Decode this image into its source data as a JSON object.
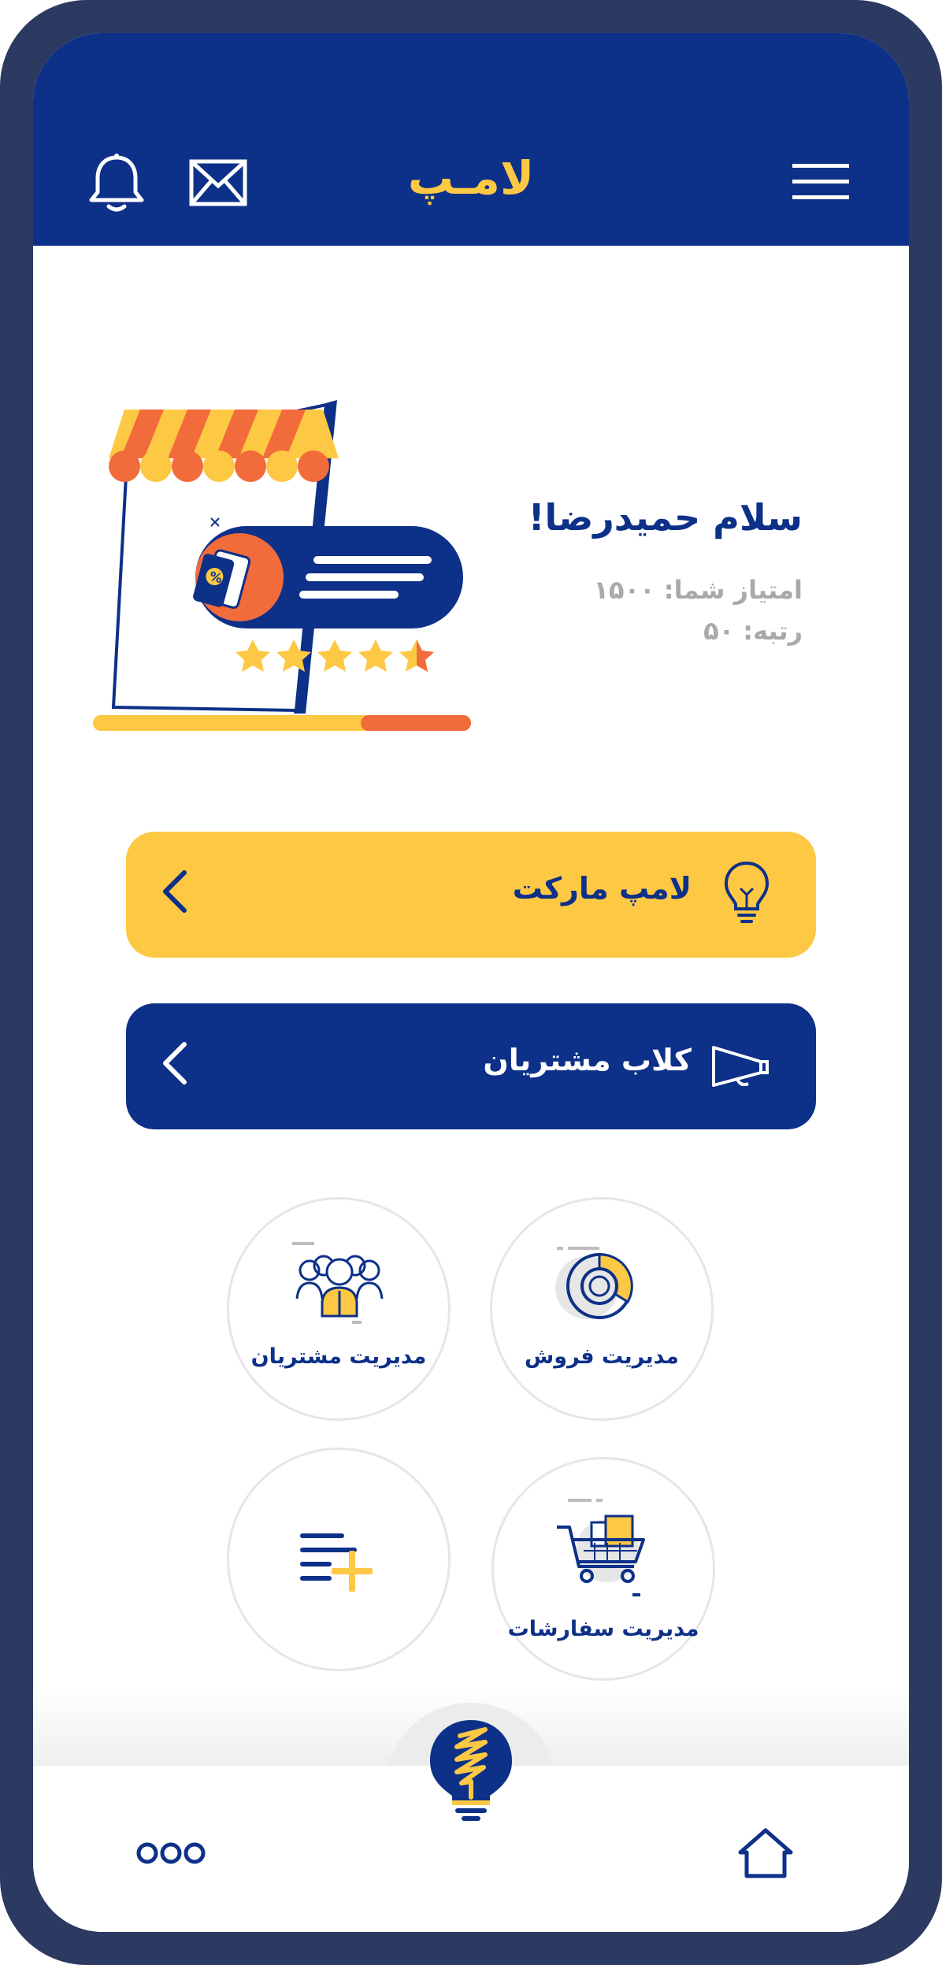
{
  "header": {
    "title": "لامـپ",
    "menu_icon": "hamburger-menu-icon",
    "mail_icon": "envelope-icon",
    "bell_icon": "bell-icon"
  },
  "profile": {
    "greeting": "سلام حمیدرضا!",
    "points_line": "امتیاز شما: ۱۵۰۰",
    "rank_line": "رتبه: ۵۰",
    "rating_stars": 4.5,
    "illustration": "storefront-illustration"
  },
  "actions": {
    "market": {
      "label": "لامپ مارکت",
      "icon": "lightbulb-icon"
    },
    "club": {
      "label": "کلاب مشتریان",
      "icon": "megaphone-icon"
    }
  },
  "tiles": {
    "sales": {
      "label": "مدیریت فروش",
      "icon": "pie-chart-icon"
    },
    "customers": {
      "label": "مدیریت مشتریان",
      "icon": "users-group-icon"
    },
    "orders": {
      "label": "مدیریت سفارشات",
      "icon": "shopping-cart-icon"
    },
    "add": {
      "label": "",
      "icon": "add-list-icon"
    }
  },
  "bottom_nav": {
    "more_icon": "more-dots-icon",
    "home_icon": "home-icon",
    "center_icon": "bulb-logo-icon"
  },
  "colors": {
    "primary": "#0d3088",
    "accent": "#fdc844",
    "frame": "#2c3a61",
    "orange": "#f26b3a"
  }
}
